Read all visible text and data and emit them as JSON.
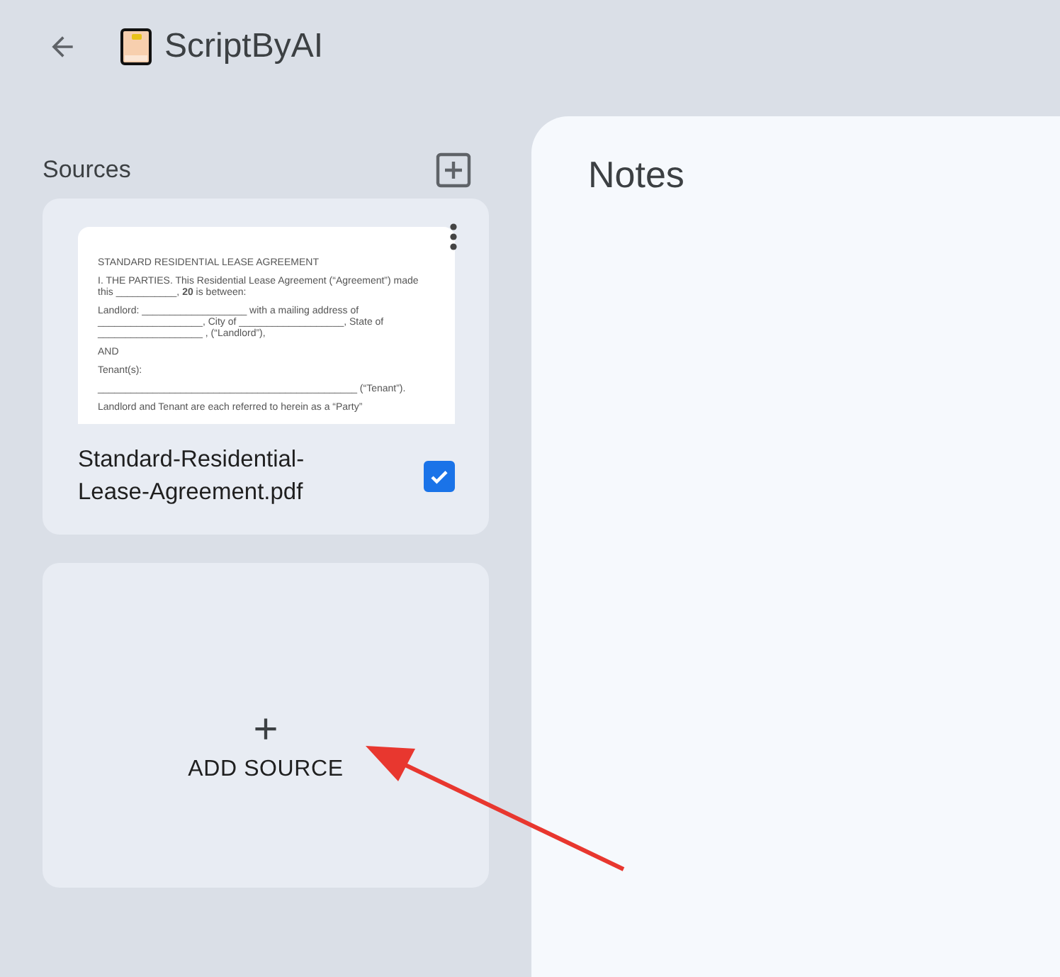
{
  "header": {
    "title": "ScriptByAI"
  },
  "sources": {
    "heading": "Sources",
    "items": [
      {
        "name": "Standard-Residential-Lease-Agreement.pdf",
        "checked": true,
        "preview": [
          "STANDARD RESIDENTIAL LEASE AGREEMENT",
          "I. THE PARTIES. This Residential Lease Agreement (“Agreement”) made this ___________, **20** is between:",
          "Landlord: ___________________ with a mailing address of ___________________, City of ___________________, State of ___________________ , (“Landlord”),",
          "AND",
          "Tenant(s):",
          "_______________________________________________ (“Tenant”).",
          "Landlord and Tenant are each referred to herein as a “Party”"
        ]
      }
    ],
    "add_label": "ADD SOURCE",
    "add_symbol": "+"
  },
  "notes": {
    "title": "Notes"
  }
}
